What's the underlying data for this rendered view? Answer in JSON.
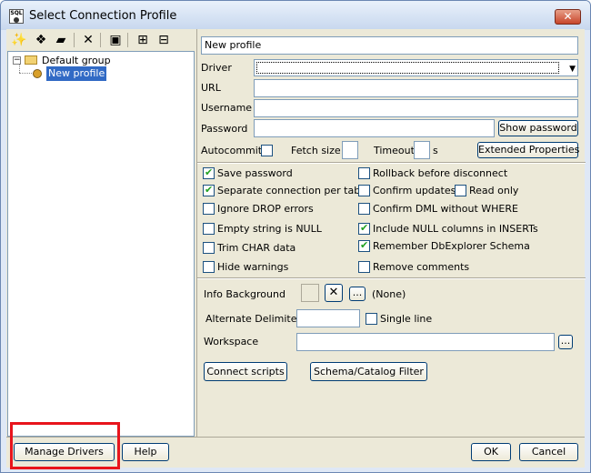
{
  "window": {
    "title": "Select Connection Profile",
    "app_icon_text": "SQL",
    "close_glyph": "✕"
  },
  "toolbar": {
    "icons": [
      "new-profile-icon",
      "copy-profile-icon",
      "new-group-icon",
      "delete-icon",
      "save-icon",
      "expand-all-icon",
      "collapse-all-icon"
    ]
  },
  "tree": {
    "group": {
      "label": "Default group",
      "expander": "−"
    },
    "profile": {
      "label": "New profile"
    }
  },
  "form": {
    "profile_name": "New profile",
    "driver_label": "Driver",
    "driver_value": "",
    "url_label": "URL",
    "url_value": "",
    "username_label": "Username",
    "username_value": "",
    "password_label": "Password",
    "password_value": "",
    "show_password": "Show password",
    "autocommit_label": "Autocommit",
    "fetch_size_label": "Fetch size",
    "fetch_size_value": "",
    "timeout_label": "Timeout",
    "timeout_value": "",
    "timeout_unit": "s",
    "extended_properties": "Extended Properties"
  },
  "options": {
    "left": [
      {
        "label": "Save password",
        "checked": true
      },
      {
        "label": "Separate connection per tab",
        "checked": true
      },
      {
        "label": "Ignore DROP errors",
        "checked": false
      },
      {
        "label": "Empty string is NULL",
        "checked": false
      },
      {
        "label": "Trim CHAR data",
        "checked": false
      },
      {
        "label": "Hide warnings",
        "checked": false
      }
    ],
    "right": [
      {
        "label": "Rollback before disconnect",
        "checked": false
      },
      {
        "label": "Confirm updates",
        "checked": false
      },
      {
        "label": "Confirm DML without WHERE",
        "checked": false
      },
      {
        "label": "Include NULL columns in INSERTs",
        "checked": true
      },
      {
        "label": "Remember DbExplorer Schema",
        "checked": true
      },
      {
        "label": "Remove comments",
        "checked": false
      }
    ],
    "read_only": {
      "label": "Read only",
      "checked": false
    }
  },
  "extras": {
    "info_bg_label": "Info Background",
    "color_none": "(None)",
    "browse": "...",
    "alt_delim_label": "Alternate Delimiter",
    "alt_delim_value": "",
    "single_line": "Single line",
    "workspace_label": "Workspace",
    "workspace_value": "",
    "connect_scripts": "Connect scripts",
    "schema_filter": "Schema/Catalog Filter"
  },
  "footer": {
    "manage_drivers": "Manage Drivers",
    "help": "Help",
    "ok": "OK",
    "cancel": "Cancel"
  },
  "colors": {
    "selection": "#316ac5",
    "highlight": "#e8141c",
    "titlebar": "#c7d7ee"
  }
}
